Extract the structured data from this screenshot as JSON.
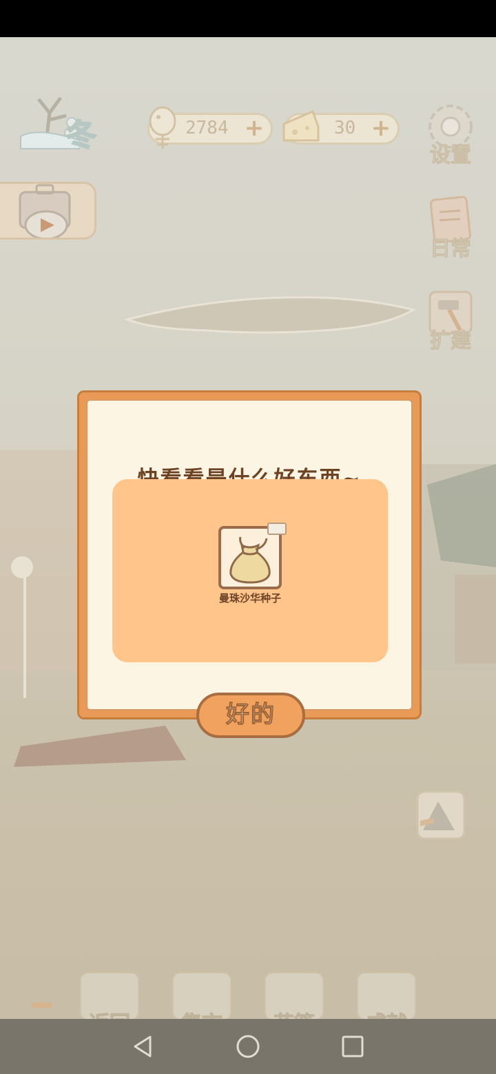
{
  "hud": {
    "season": "冬",
    "fish_count": "2784",
    "cheese_count": "30",
    "plus_symbol": "+"
  },
  "side_buttons": {
    "settings": "设置",
    "daily": "日常",
    "expand": "扩建"
  },
  "dialog": {
    "title": "快看看是什么好东西~",
    "item_name": "曼珠沙华种子",
    "item_icon": "seed-bag-icon",
    "ok_label": "好的"
  },
  "bottom_bar": {
    "items": [
      "返回",
      "集市",
      "花篮",
      "成就"
    ]
  },
  "colors": {
    "dialog_frame": "#e99a56",
    "dialog_panel": "#fcf5e4",
    "reward_area": "#ffc58b",
    "title_text": "#6e4323"
  }
}
